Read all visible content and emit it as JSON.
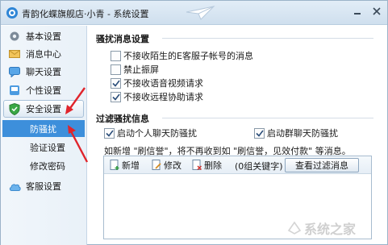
{
  "window": {
    "title": "青韵化蝶旗舰店·小青 - 系统设置"
  },
  "sidebar": {
    "items": [
      {
        "label": "基本设置",
        "icon": "gear-icon"
      },
      {
        "label": "消息中心",
        "icon": "envelope-icon"
      },
      {
        "label": "聊天设置",
        "icon": "chat-icon"
      },
      {
        "label": "个性设置",
        "icon": "palette-icon"
      },
      {
        "label": "安全设置",
        "icon": "shield-icon"
      },
      {
        "label": "客服设置",
        "icon": "cloud-icon"
      }
    ],
    "sub_items": [
      {
        "label": "防骚扰",
        "selected": true
      },
      {
        "label": "验证设置",
        "selected": false
      },
      {
        "label": "修改密码",
        "selected": false
      }
    ]
  },
  "harass": {
    "title": "骚扰消息设置",
    "options": [
      {
        "label": "不接收陌生的E客服子帐号的消息",
        "checked": false
      },
      {
        "label": "禁止振屏",
        "checked": false
      },
      {
        "label": "不接收语音视频请求",
        "checked": true
      },
      {
        "label": "不接收远程协助请求",
        "checked": true
      }
    ]
  },
  "filter": {
    "title": "过滤骚扰信息",
    "personal_label": "启动个人聊天防骚扰",
    "personal_checked": true,
    "group_label": "启动群聊天防骚扰",
    "group_checked": true,
    "note": "如新增 \"刷信誉\"，将不再收到如 \"刷信誉，见效付款\" 等消息。",
    "add_label": "新增",
    "edit_label": "修改",
    "delete_label": "删除",
    "count_label": "(0组关键字)",
    "view_label": "查看过滤消息"
  },
  "watermark": {
    "text": "系统之家"
  },
  "colors": {
    "selected": "#3d8fdb",
    "arrow": "#e0242b",
    "titlebar": "#d6e4f2"
  }
}
